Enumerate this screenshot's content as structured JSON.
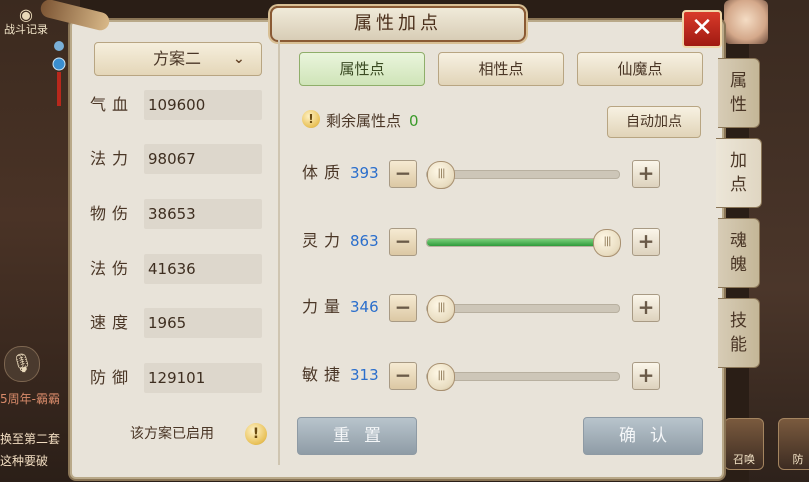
{
  "background": {
    "battle_log_label": "战斗记录",
    "chat_lines": [
      "5周年-霸霸",
      "换至第二套",
      "这种要破"
    ],
    "bottom_icon_labels": [
      "召唤",
      "防"
    ]
  },
  "window": {
    "title": "属性加点",
    "close_icon": "close-icon"
  },
  "plan": {
    "selected": "方案二",
    "status_text": "该方案已启用"
  },
  "stats": [
    {
      "label": "气血",
      "value": "109600"
    },
    {
      "label": "法力",
      "value": "98067"
    },
    {
      "label": "物伤",
      "value": "38653"
    },
    {
      "label": "法伤",
      "value": "41636"
    },
    {
      "label": "速度",
      "value": "1965"
    },
    {
      "label": "防御",
      "value": "129101"
    }
  ],
  "tabs": [
    {
      "label": "属性点",
      "active": true
    },
    {
      "label": "相性点",
      "active": false
    },
    {
      "label": "仙魔点",
      "active": false
    }
  ],
  "remaining": {
    "label": "剩余属性点",
    "value": "0"
  },
  "auto_button": "自动加点",
  "attributes": [
    {
      "label": "体质",
      "value": "393",
      "level": 0
    },
    {
      "label": "灵力",
      "value": "863",
      "level": 1
    },
    {
      "label": "力量",
      "value": "346",
      "level": 0
    },
    {
      "label": "敏捷",
      "value": "313",
      "level": 0
    }
  ],
  "buttons": {
    "reset": "重置",
    "confirm": "确认"
  },
  "side_tabs": [
    {
      "label": "属性",
      "active": false
    },
    {
      "label": "加点",
      "active": true
    },
    {
      "label": "魂魄",
      "active": false
    },
    {
      "label": "技能",
      "active": false
    }
  ],
  "colors": {
    "accent_value": "#2a6ecc",
    "remaining_value": "#3a9a2a",
    "slider_fill": "#2f9a3c",
    "close_button": "#c8281a"
  }
}
